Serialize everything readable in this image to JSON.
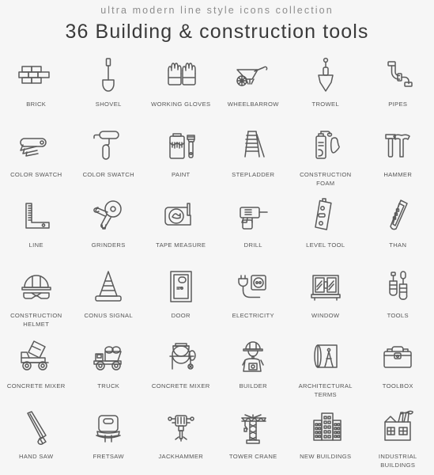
{
  "header": {
    "subtitle": "ultra modern line style icons collection",
    "title": "36 Building & construction tools"
  },
  "style": {
    "background": "#f6f6f6",
    "stroke": "#5a5a5a",
    "label_color": "#565656",
    "title_color": "#3a3a3a",
    "subtitle_color": "#8d8d8d"
  },
  "grid": {
    "columns": 6,
    "rows": 6,
    "count": 36,
    "items": [
      {
        "label": "BRICK",
        "icon": "brick-icon"
      },
      {
        "label": "SHOVEL",
        "icon": "shovel-icon"
      },
      {
        "label": "WORKING GLOVES",
        "icon": "working-gloves-icon"
      },
      {
        "label": "WHEELBARROW",
        "icon": "wheelbarrow-icon"
      },
      {
        "label": "TROWEL",
        "icon": "trowel-icon"
      },
      {
        "label": "PIPES",
        "icon": "pipes-icon"
      },
      {
        "label": "COLOR SWATCH",
        "icon": "color-swatch-fan-icon"
      },
      {
        "label": "COLOR SWATCH",
        "icon": "paint-roller-icon"
      },
      {
        "label": "PAINT",
        "icon": "paint-can-brush-icon"
      },
      {
        "label": "STEPLADDER",
        "icon": "stepladder-icon"
      },
      {
        "label": "CONSTRUCTION FOAM",
        "icon": "construction-foam-icon"
      },
      {
        "label": "HAMMER",
        "icon": "hammer-icon"
      },
      {
        "label": "LINE",
        "icon": "square-ruler-icon"
      },
      {
        "label": "GRINDERS",
        "icon": "angle-grinder-icon"
      },
      {
        "label": "TAPE MEASURE",
        "icon": "tape-measure-icon"
      },
      {
        "label": "DRILL",
        "icon": "drill-icon"
      },
      {
        "label": "LEVEL TOOL",
        "icon": "level-tool-icon"
      },
      {
        "label": "THAN",
        "icon": "utility-knife-icon"
      },
      {
        "label": "CONSTRUCTION HELMET",
        "icon": "construction-helmet-icon"
      },
      {
        "label": "CONUS SIGNAL",
        "icon": "traffic-cone-icon"
      },
      {
        "label": "DOOR",
        "icon": "door-icon"
      },
      {
        "label": "ELECTRICITY",
        "icon": "electricity-plug-socket-icon"
      },
      {
        "label": "WINDOW",
        "icon": "window-icon"
      },
      {
        "label": "TOOLS",
        "icon": "screwdrivers-icon"
      },
      {
        "label": "CONCRETE MIXER",
        "icon": "concrete-mixer-truck-icon"
      },
      {
        "label": "TRUCK",
        "icon": "dump-truck-icon"
      },
      {
        "label": "CONCRETE MIXER",
        "icon": "concrete-mixer-drum-icon"
      },
      {
        "label": "BUILDER",
        "icon": "builder-icon"
      },
      {
        "label": "ARCHITECTURAL TERMS",
        "icon": "blueprint-compass-icon"
      },
      {
        "label": "TOOLBOX",
        "icon": "toolbox-icon"
      },
      {
        "label": "HAND SAW",
        "icon": "hand-saw-icon"
      },
      {
        "label": "FRETSAW",
        "icon": "fretsaw-icon"
      },
      {
        "label": "JACKHAMMER",
        "icon": "jackhammer-icon"
      },
      {
        "label": "TOWER CRANE",
        "icon": "tower-crane-icon"
      },
      {
        "label": "NEW BUILDINGS",
        "icon": "new-buildings-icon"
      },
      {
        "label": "INDUSTRIAL BUILDINGS",
        "icon": "industrial-buildings-icon"
      }
    ]
  }
}
